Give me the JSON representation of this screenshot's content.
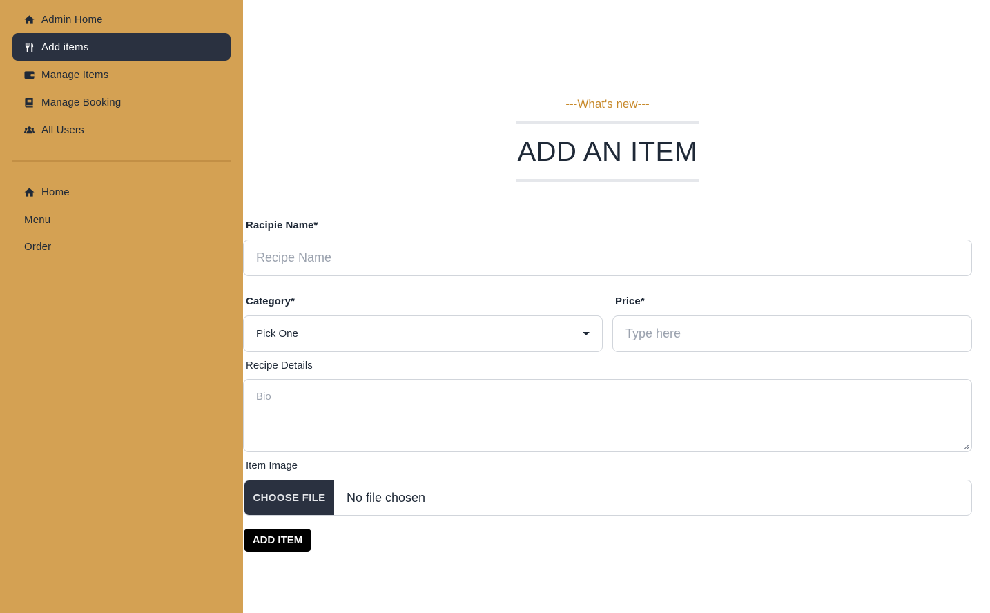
{
  "sidebar": {
    "main_items": [
      {
        "label": "Admin Home",
        "icon": "home-icon"
      },
      {
        "label": "Add items",
        "icon": "utensils-icon",
        "active": true
      },
      {
        "label": "Manage Items",
        "icon": "wallet-icon"
      },
      {
        "label": "Manage Booking",
        "icon": "book-icon"
      },
      {
        "label": "All Users",
        "icon": "users-icon"
      }
    ],
    "secondary_items": [
      {
        "label": "Home",
        "icon": "home-icon"
      },
      {
        "label": "Menu"
      },
      {
        "label": "Order"
      }
    ]
  },
  "header": {
    "subheading": "---What's new---",
    "title": "ADD AN ITEM"
  },
  "form": {
    "recipe_name": {
      "label": "Racipie Name*",
      "placeholder": "Recipe Name"
    },
    "category": {
      "label": "Category*",
      "selected": "Pick One"
    },
    "price": {
      "label": "Price*",
      "placeholder": "Type here"
    },
    "details": {
      "label": "Recipe Details",
      "placeholder": "Bio"
    },
    "image": {
      "label": "Item Image",
      "button": "CHOOSE FILE",
      "status": "No file chosen"
    },
    "submit": "ADD ITEM"
  },
  "colors": {
    "sidebar_bg": "#d4a153",
    "active_bg": "#2a3140",
    "accent": "#c7892a"
  }
}
